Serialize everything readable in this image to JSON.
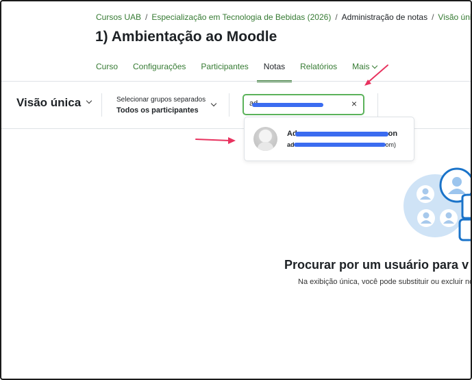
{
  "breadcrumb": {
    "items": [
      "Cursos UAB",
      "Especialização em Tecnologia de Bebidas (2026)",
      "Administração de notas",
      "Visão única"
    ],
    "separator": "/"
  },
  "page": {
    "title": "1) Ambientação ao Moodle"
  },
  "tabs": [
    {
      "label": "Curso"
    },
    {
      "label": "Configurações"
    },
    {
      "label": "Participantes"
    },
    {
      "label": "Notas",
      "active": true
    },
    {
      "label": "Relatórios"
    },
    {
      "label": "Mais"
    }
  ],
  "toolbar": {
    "view_label": "Visão única",
    "group_select_label": "Selecionar grupos separados",
    "group_select_value": "Todos os participantes",
    "search_value": "ad"
  },
  "search_results": [
    {
      "name_start": "Ad",
      "name_end": "on",
      "email_start": "ad",
      "email_end": "om)"
    }
  ],
  "empty_state": {
    "title": "Procurar por um usuário para v",
    "text": "Na exibição única, você pode substituir ou excluir nota"
  },
  "colors": {
    "accent": "#357a32",
    "search_border": "#5bb25a",
    "annotation_arrow": "#e8335f",
    "redaction": "#3b6cf0",
    "illustration_light": "#cfe3f6",
    "illustration_dark": "#1a73c9"
  },
  "icons": [
    "chevron-down-icon",
    "close-icon",
    "user-avatar-icon",
    "users-illustration",
    "pointing-hand-icon",
    "annotation-arrow"
  ]
}
